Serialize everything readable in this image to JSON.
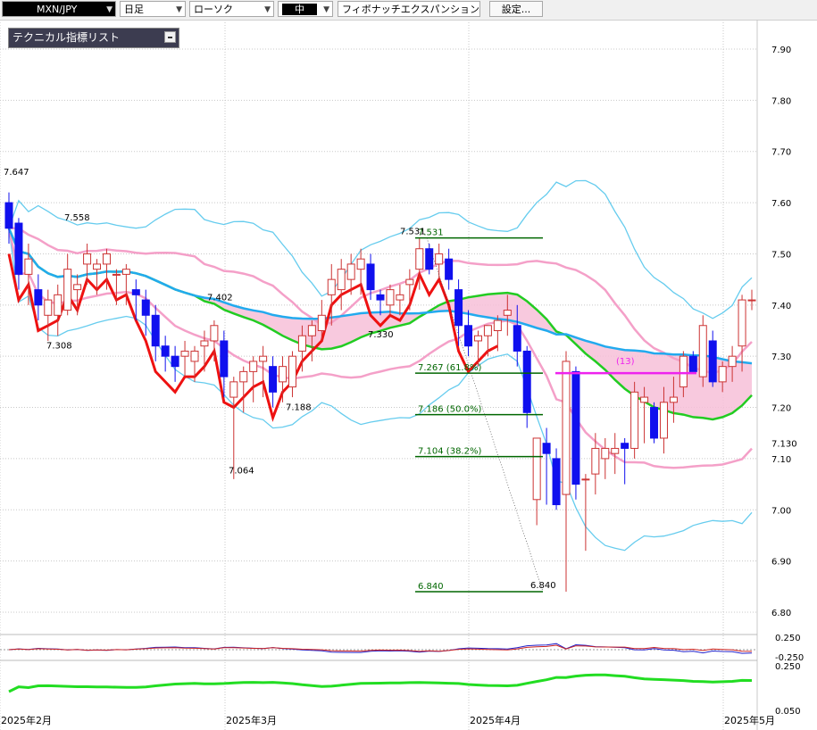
{
  "toolbar": {
    "pair": "MXN/JPY",
    "period": "日足",
    "chart_style": "ローソク",
    "size": "中",
    "indicator": "フィボナッチエクスパンション",
    "settings_button": "設定..."
  },
  "indicator_list_label": "テクニカル指標リスト",
  "colors": {
    "up_candle": "#cc3333",
    "down_candle": "#1010ee",
    "bb_outer": "#66ccee",
    "bb_middle_green": "#22cc22",
    "bb_pink": "#f4a0c8",
    "cloud": "#f7c0d8",
    "cloud_blue": "#b8d8f0",
    "ma_blue": "#22aaee",
    "red_line": "#ee1111",
    "fib_line": "#006600",
    "projection": "#ee22ee"
  },
  "chart_data": {
    "type": "candlestick",
    "x_labels": [
      "2025年2月",
      "2025年3月",
      "2025年4月",
      "2025年5月"
    ],
    "y_ticks": [
      "7.90",
      "7.80",
      "7.70",
      "7.60",
      "7.50",
      "7.40",
      "7.30",
      "7.20",
      "7.10",
      "7.00",
      "6.90",
      "6.80"
    ],
    "ylim": [
      6.76,
      7.95
    ],
    "current_price_label": "7.130",
    "annotations": [
      "7.647",
      "7.558",
      "7.402",
      "7.308",
      "7.330",
      "7.188",
      "7.064",
      "7.531",
      "6.840"
    ],
    "fib_levels": [
      {
        "label": "7.531",
        "value": 7.531
      },
      {
        "label": "7.267 (61.8%)",
        "value": 7.267
      },
      {
        "label": "7.186 (50.0%)",
        "value": 7.186
      },
      {
        "label": "7.104 (38.2%)",
        "value": 7.104
      },
      {
        "label": "6.840",
        "value": 6.84
      }
    ],
    "projection_label": "(13)",
    "candles": [
      [
        7.6,
        7.62,
        7.52,
        7.55
      ],
      [
        7.56,
        7.57,
        7.43,
        7.46
      ],
      [
        7.46,
        7.52,
        7.4,
        7.49
      ],
      [
        7.43,
        7.46,
        7.37,
        7.4
      ],
      [
        7.38,
        7.43,
        7.33,
        7.41
      ],
      [
        7.38,
        7.44,
        7.34,
        7.42
      ],
      [
        7.39,
        7.5,
        7.38,
        7.47
      ],
      [
        7.43,
        7.46,
        7.38,
        7.44
      ],
      [
        7.48,
        7.52,
        7.44,
        7.5
      ],
      [
        7.47,
        7.49,
        7.42,
        7.48
      ],
      [
        7.48,
        7.51,
        7.43,
        7.5
      ],
      [
        7.46,
        7.47,
        7.4,
        7.46
      ],
      [
        7.46,
        7.48,
        7.4,
        7.47
      ],
      [
        7.43,
        7.45,
        7.37,
        7.42
      ],
      [
        7.41,
        7.43,
        7.34,
        7.38
      ],
      [
        7.38,
        7.4,
        7.29,
        7.32
      ],
      [
        7.32,
        7.34,
        7.27,
        7.3
      ],
      [
        7.3,
        7.32,
        7.25,
        7.28
      ],
      [
        7.3,
        7.33,
        7.26,
        7.31
      ],
      [
        7.29,
        7.32,
        7.25,
        7.31
      ],
      [
        7.32,
        7.35,
        7.27,
        7.33
      ],
      [
        7.33,
        7.37,
        7.29,
        7.36
      ],
      [
        7.33,
        7.35,
        7.22,
        7.26
      ],
      [
        7.22,
        7.26,
        7.06,
        7.25
      ],
      [
        7.25,
        7.28,
        7.19,
        7.27
      ],
      [
        7.27,
        7.3,
        7.21,
        7.29
      ],
      [
        7.29,
        7.32,
        7.22,
        7.3
      ],
      [
        7.28,
        7.3,
        7.2,
        7.23
      ],
      [
        7.25,
        7.3,
        7.21,
        7.28
      ],
      [
        7.24,
        7.31,
        7.22,
        7.3
      ],
      [
        7.31,
        7.36,
        7.27,
        7.34
      ],
      [
        7.34,
        7.37,
        7.29,
        7.36
      ],
      [
        7.35,
        7.41,
        7.33,
        7.38
      ],
      [
        7.42,
        7.48,
        7.36,
        7.45
      ],
      [
        7.43,
        7.49,
        7.39,
        7.47
      ],
      [
        7.45,
        7.5,
        7.42,
        7.48
      ],
      [
        7.47,
        7.51,
        7.42,
        7.49
      ],
      [
        7.48,
        7.5,
        7.41,
        7.43
      ],
      [
        7.42,
        7.43,
        7.38,
        7.41
      ],
      [
        7.4,
        7.44,
        7.38,
        7.43
      ],
      [
        7.41,
        7.44,
        7.38,
        7.42
      ],
      [
        7.44,
        7.47,
        7.39,
        7.45
      ],
      [
        7.47,
        7.53,
        7.43,
        7.51
      ],
      [
        7.51,
        7.52,
        7.46,
        7.47
      ],
      [
        7.48,
        7.52,
        7.45,
        7.5
      ],
      [
        7.49,
        7.51,
        7.43,
        7.45
      ],
      [
        7.43,
        7.45,
        7.32,
        7.36
      ],
      [
        7.36,
        7.39,
        7.3,
        7.32
      ],
      [
        7.33,
        7.35,
        7.28,
        7.34
      ],
      [
        7.34,
        7.36,
        7.3,
        7.36
      ],
      [
        7.35,
        7.38,
        7.31,
        7.37
      ],
      [
        7.38,
        7.42,
        7.34,
        7.39
      ],
      [
        7.36,
        7.4,
        7.28,
        7.31
      ],
      [
        7.31,
        7.32,
        7.16,
        7.19
      ],
      [
        7.02,
        7.14,
        6.97,
        7.14
      ],
      [
        7.13,
        7.16,
        7.01,
        7.11
      ],
      [
        7.1,
        7.12,
        7.0,
        7.01
      ],
      [
        7.03,
        7.31,
        6.84,
        7.29
      ],
      [
        7.27,
        7.28,
        7.02,
        7.05
      ],
      [
        7.06,
        7.07,
        6.92,
        7.06
      ],
      [
        7.07,
        7.15,
        7.03,
        7.12
      ],
      [
        7.1,
        7.14,
        7.06,
        7.12
      ],
      [
        7.11,
        7.15,
        7.07,
        7.12
      ],
      [
        7.13,
        7.14,
        7.05,
        7.12
      ],
      [
        7.12,
        7.25,
        7.1,
        7.23
      ],
      [
        7.21,
        7.24,
        7.13,
        7.22
      ],
      [
        7.2,
        7.21,
        7.13,
        7.14
      ],
      [
        7.14,
        7.24,
        7.11,
        7.21
      ],
      [
        7.21,
        7.26,
        7.17,
        7.22
      ],
      [
        7.24,
        7.31,
        7.22,
        7.3
      ],
      [
        7.3,
        7.31,
        7.27,
        7.27
      ],
      [
        7.26,
        7.38,
        7.24,
        7.36
      ],
      [
        7.33,
        7.35,
        7.24,
        7.25
      ],
      [
        7.25,
        7.29,
        7.23,
        7.28
      ],
      [
        7.28,
        7.32,
        7.25,
        7.3
      ],
      [
        7.32,
        7.42,
        7.27,
        7.41
      ],
      [
        7.41,
        7.43,
        7.39,
        7.41
      ]
    ]
  },
  "sub_axis_labels": [
    "0.250",
    "-0.250",
    "0.250",
    "0.050"
  ]
}
